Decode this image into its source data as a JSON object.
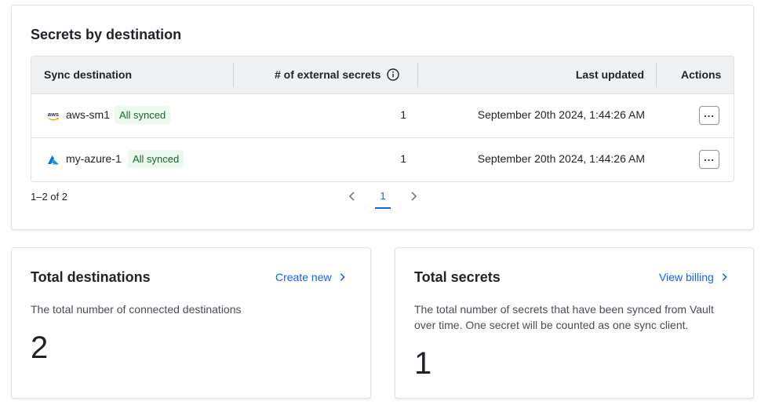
{
  "secrets_by_destination": {
    "title": "Secrets by destination",
    "columns": {
      "destination": "Sync destination",
      "count": "# of external secrets",
      "updated": "Last updated",
      "actions": "Actions"
    },
    "rows": [
      {
        "icon": "aws-icon",
        "icon_text": "aws",
        "name": "aws-sm1",
        "status": "All synced",
        "count": "1",
        "updated": "September 20th 2024, 1:44:26 AM"
      },
      {
        "icon": "azure-icon",
        "name": "my-azure-1",
        "status": "All synced",
        "count": "1",
        "updated": "September 20th 2024, 1:44:26 AM"
      }
    ],
    "pagination": {
      "range": "1–2 of 2",
      "current_page": "1"
    }
  },
  "total_destinations": {
    "title": "Total destinations",
    "link": "Create new",
    "description": "The total number of connected destinations",
    "value": "2"
  },
  "total_secrets": {
    "title": "Total secrets",
    "link": "View billing",
    "description_line1": "The total number of secrets that have been synced from Vault",
    "description_line2": "over time. One secret will be counted as one sync client.",
    "value": "1"
  },
  "colors": {
    "link": "#1060ff",
    "badge_text": "#15692f",
    "badge_bg": "#ebf9ef",
    "aws_orange": "#ff9900",
    "azure_blue": "#0078d4"
  }
}
